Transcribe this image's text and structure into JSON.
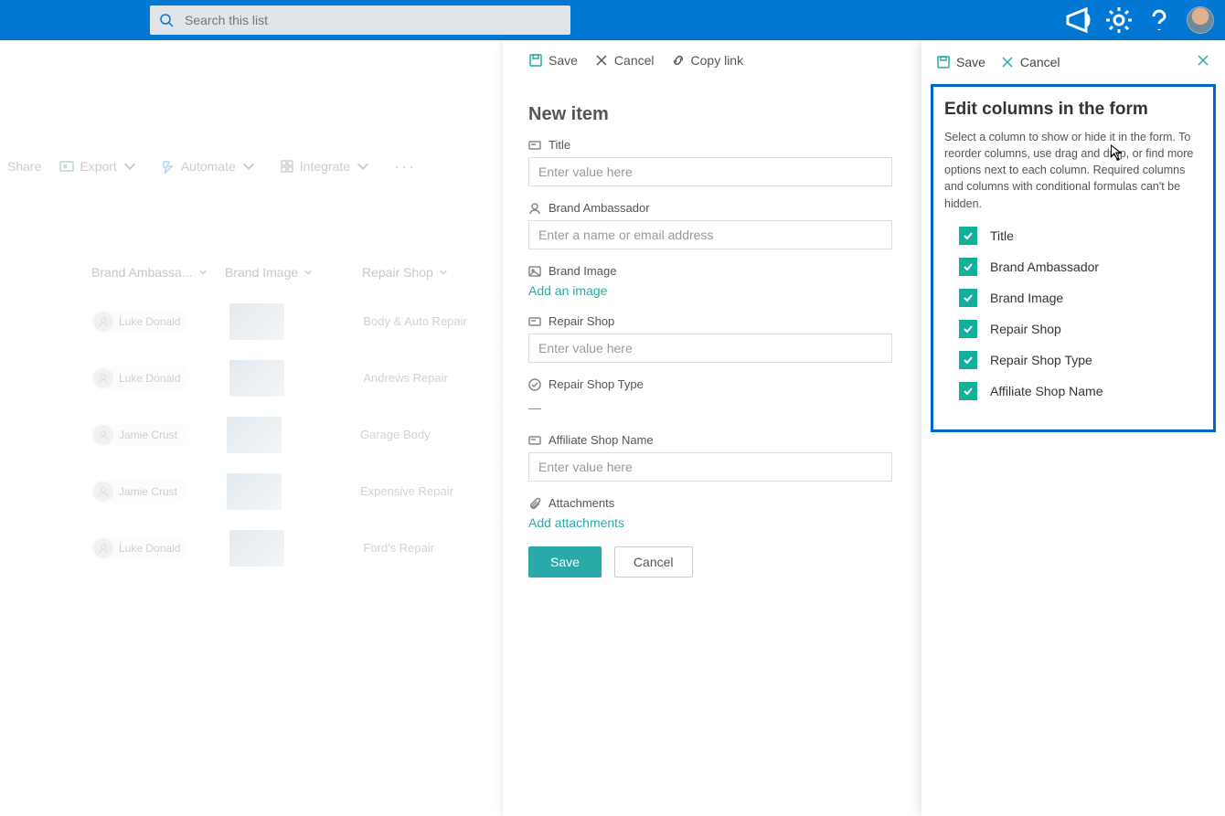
{
  "header": {
    "search_placeholder": "Search this list"
  },
  "toolbar": {
    "share": "Share",
    "export": "Export",
    "automate": "Automate",
    "integrate": "Integrate"
  },
  "columns": {
    "brand_ambassador": "Brand Ambassa...",
    "brand_image": "Brand Image",
    "repair_shop": "Repair Shop"
  },
  "rows": [
    {
      "person": "Luke Donald",
      "repair_shop": "Body & Auto Repair"
    },
    {
      "person": "Luke Donald",
      "repair_shop": "Andrews Repair"
    },
    {
      "person": "Jamie Crust",
      "repair_shop": "Garage Body"
    },
    {
      "person": "Jamie Crust",
      "repair_shop": "Expensive Repair"
    },
    {
      "person": "Luke Donald",
      "repair_shop": "Ford's Repair"
    }
  ],
  "mid_panel": {
    "bar": {
      "save": "Save",
      "cancel": "Cancel",
      "copy_link": "Copy link"
    },
    "title": "New item",
    "fields": {
      "title": {
        "label": "Title",
        "placeholder": "Enter value here"
      },
      "brand_ambassador": {
        "label": "Brand Ambassador",
        "placeholder": "Enter a name or email address"
      },
      "brand_image": {
        "label": "Brand Image",
        "action": "Add an image"
      },
      "repair_shop": {
        "label": "Repair Shop",
        "placeholder": "Enter value here"
      },
      "repair_shop_type": {
        "label": "Repair Shop Type",
        "value": "—"
      },
      "affiliate_shop_name": {
        "label": "Affiliate Shop Name",
        "placeholder": "Enter value here"
      },
      "attachments": {
        "label": "Attachments",
        "action": "Add attachments"
      }
    },
    "actions": {
      "save": "Save",
      "cancel": "Cancel"
    }
  },
  "right_panel": {
    "bar": {
      "save": "Save",
      "cancel": "Cancel"
    },
    "title": "Edit columns in the form",
    "description": "Select a column to show or hide it in the form. To reorder columns, use drag and drop, or find more options next to each column. Required columns and columns with conditional formulas can't be hidden.",
    "items": [
      "Title",
      "Brand Ambassador",
      "Brand Image",
      "Repair Shop",
      "Repair Shop Type",
      "Affiliate Shop Name"
    ]
  }
}
